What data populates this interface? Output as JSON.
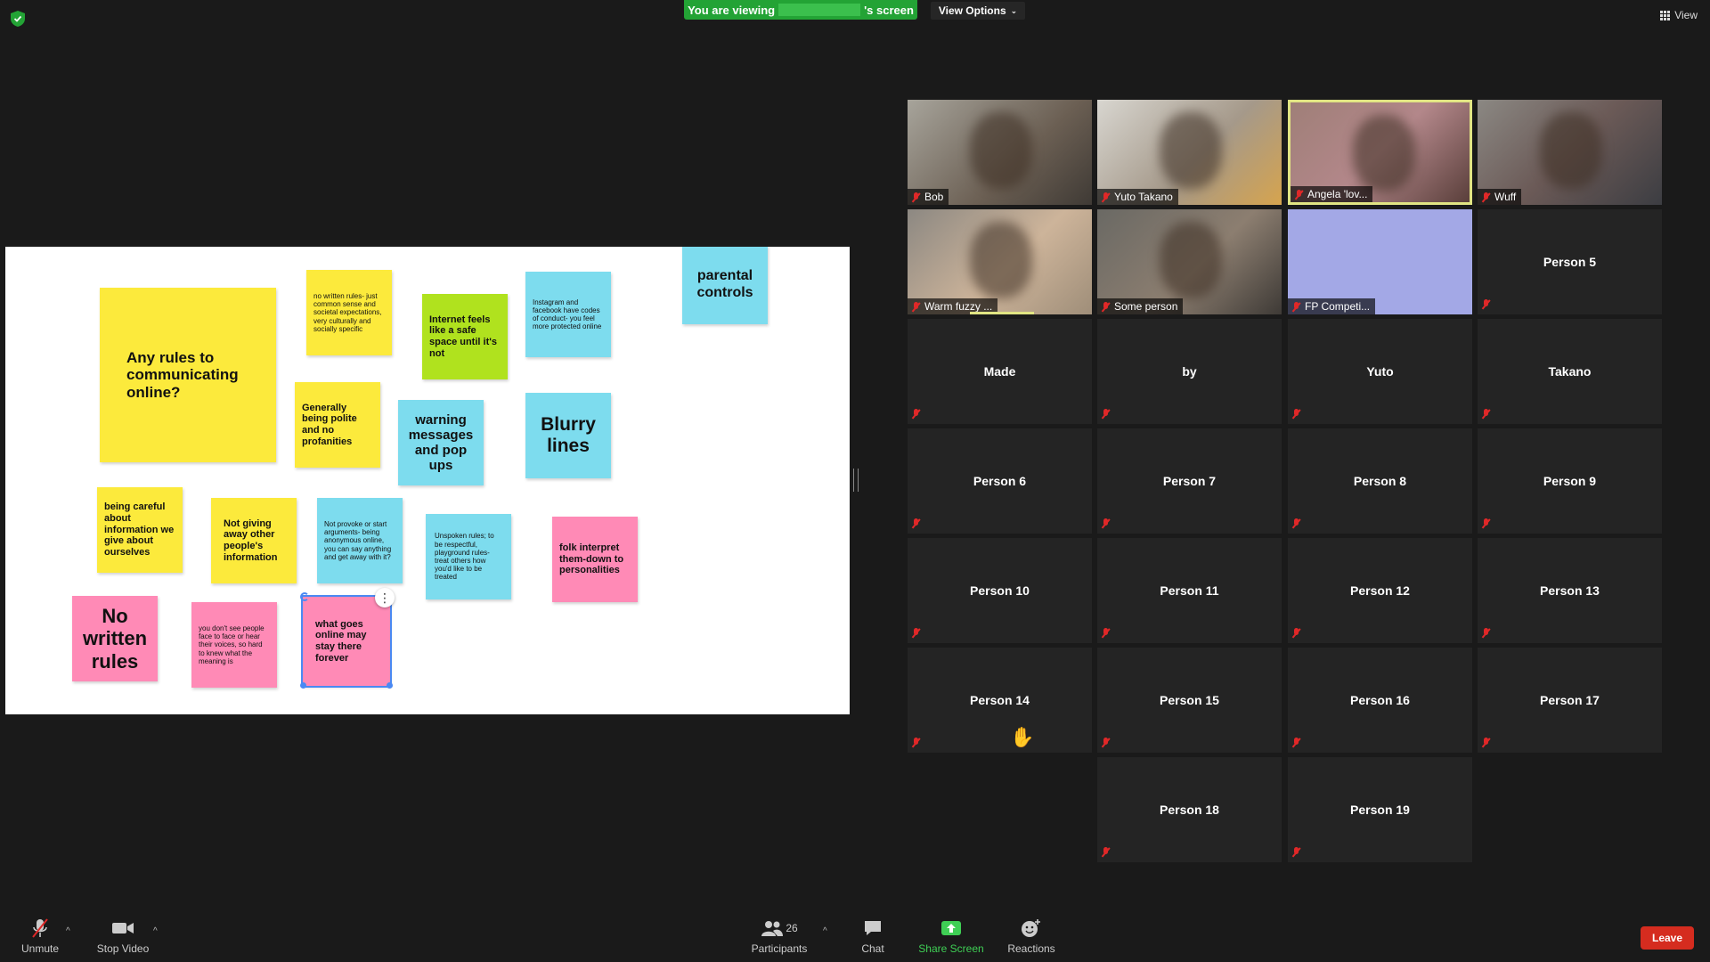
{
  "topbar": {
    "viewing_prefix": "You are viewing",
    "viewing_suffix": "'s screen",
    "view_options": "View Options",
    "view": "View"
  },
  "whiteboard": {
    "notes": [
      {
        "text": "Any rules to communicating online?",
        "color": "yellow"
      },
      {
        "text": "no written rules- just common sense and societal expectations, very culturally and socially specific",
        "color": "yellow"
      },
      {
        "text": "Internet feels like a safe space until it's not",
        "color": "lime"
      },
      {
        "text": "Instagram and facebook have codes of conduct- you feel more protected online",
        "color": "cyan"
      },
      {
        "text": "parental controls",
        "color": "cyan"
      },
      {
        "text": "Generally being polite and no profanities",
        "color": "yellow"
      },
      {
        "text": "warning messages and pop ups",
        "color": "cyan"
      },
      {
        "text": "Blurry lines",
        "color": "cyan"
      },
      {
        "text": "being careful about information we give about ourselves",
        "color": "yellow"
      },
      {
        "text": "Not giving away other people's information",
        "color": "yellow"
      },
      {
        "text": "Not provoke or start arguments- being anonymous online, you can say anything and get away with it?",
        "color": "cyan"
      },
      {
        "text": "Unspoken rules; to be respectful, playground rules- treat others how you'd like to be treated",
        "color": "cyan"
      },
      {
        "text": "folk interpret them-down to personalities",
        "color": "pink"
      },
      {
        "text": "No written rules",
        "color": "pink"
      },
      {
        "text": "you don't see people face to face or hear their voices, so hard to knew what the meaning is",
        "color": "pink"
      },
      {
        "text": "what goes online may stay there forever",
        "color": "pink"
      }
    ],
    "more_glyph": "⋮"
  },
  "participants": [
    {
      "name": "Bob",
      "type": "video"
    },
    {
      "name": "Yuto Takano",
      "type": "video"
    },
    {
      "name": "Angela 'lov...",
      "type": "video",
      "speaking": true
    },
    {
      "name": "Wuff",
      "type": "video"
    },
    {
      "name": "Warm fuzzy ...",
      "type": "video"
    },
    {
      "name": "Some person",
      "type": "video"
    },
    {
      "name": "FP Competi...",
      "type": "blank"
    },
    {
      "name": "Person 5",
      "type": "name"
    },
    {
      "name": "Made",
      "type": "name"
    },
    {
      "name": "by",
      "type": "name"
    },
    {
      "name": "Yuto",
      "type": "name"
    },
    {
      "name": "Takano",
      "type": "name"
    },
    {
      "name": "Person 6",
      "type": "name"
    },
    {
      "name": "Person 7",
      "type": "name"
    },
    {
      "name": "Person 8",
      "type": "name"
    },
    {
      "name": "Person 9",
      "type": "name"
    },
    {
      "name": "Person 10",
      "type": "name"
    },
    {
      "name": "Person 11",
      "type": "name"
    },
    {
      "name": "Person 12",
      "type": "name"
    },
    {
      "name": "Person 13",
      "type": "name"
    },
    {
      "name": "Person 14",
      "type": "name"
    },
    {
      "name": "Person 15",
      "type": "name"
    },
    {
      "name": "Person 16",
      "type": "name"
    },
    {
      "name": "Person 17",
      "type": "name"
    },
    {
      "name": "Person 18",
      "type": "name"
    },
    {
      "name": "Person 19",
      "type": "name"
    }
  ],
  "toolbar": {
    "unmute": "Unmute",
    "stop_video": "Stop Video",
    "participants": "Participants",
    "participants_count": "26",
    "chat": "Chat",
    "share_screen": "Share Screen",
    "reactions": "Reactions",
    "leave": "Leave"
  },
  "colors": {
    "share_green": "#23a335",
    "speaking_border": "#e1e583",
    "leave_red": "#d52c1f",
    "mute_red": "#e02828"
  }
}
